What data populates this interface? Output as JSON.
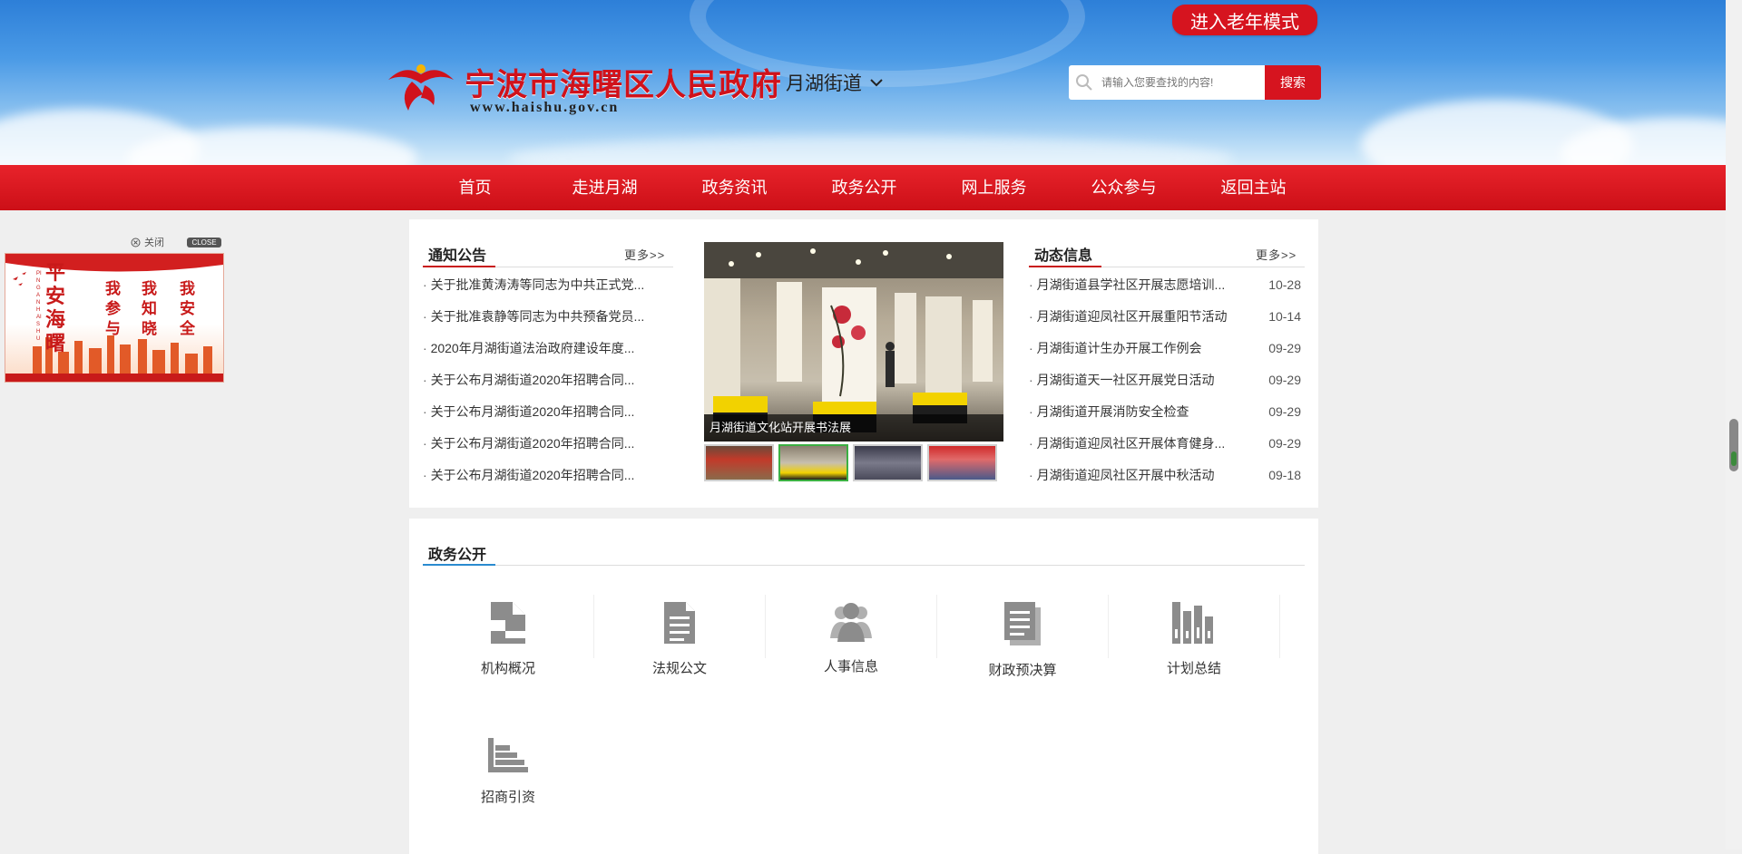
{
  "header": {
    "site_title": "宁波市海曙区人民政府",
    "site_url": "www.haishu.gov.cn",
    "district": "月湖街道",
    "elder_mode": "进入老年模式",
    "search": {
      "placeholder": "请输入您要查找的内容!",
      "button": "搜索"
    },
    "accent_color": "#d6141f"
  },
  "nav": {
    "items": [
      {
        "label": "首页"
      },
      {
        "label": "走进月湖"
      },
      {
        "label": "政务资讯"
      },
      {
        "label": "政务公开"
      },
      {
        "label": "网上服务"
      },
      {
        "label": "公众参与"
      },
      {
        "label": "返回主站"
      }
    ]
  },
  "ad": {
    "close_cn": "关闭",
    "close_en": "CLOSE",
    "slogan": "平安海曙",
    "pinyin": "PING AN HAI SHU",
    "columns": [
      "我参与",
      "我知晓",
      "我安全"
    ]
  },
  "notices": {
    "title": "通知公告",
    "more": "更多>>",
    "items": [
      {
        "text": "关于批准黄涛涛等同志为中共正式党..."
      },
      {
        "text": "关于批准袁静等同志为中共预备党员..."
      },
      {
        "text": "2020年月湖街道法治政府建设年度..."
      },
      {
        "text": "关于公布月湖街道2020年招聘合同..."
      },
      {
        "text": "关于公布月湖街道2020年招聘合同..."
      },
      {
        "text": "关于公布月湖街道2020年招聘合同..."
      },
      {
        "text": "关于公布月湖街道2020年招聘合同..."
      }
    ]
  },
  "carousel": {
    "caption": "月湖街道文化站开展书法展",
    "thumbs": 4,
    "active_index": 1
  },
  "news": {
    "title": "动态信息",
    "more": "更多>>",
    "items": [
      {
        "text": "月湖街道县学社区开展志愿培训...",
        "date": "10-28"
      },
      {
        "text": "月湖街道迎凤社区开展重阳节活动",
        "date": "10-14"
      },
      {
        "text": "月湖街道计生办开展工作例会",
        "date": "09-29"
      },
      {
        "text": "月湖街道天一社区开展党日活动",
        "date": "09-29"
      },
      {
        "text": "月湖街道开展消防安全检查",
        "date": "09-29"
      },
      {
        "text": "月湖街道迎凤社区开展体育健身...",
        "date": "09-29"
      },
      {
        "text": "月湖街道迎凤社区开展中秋活动",
        "date": "09-18"
      }
    ]
  },
  "gov_open": {
    "title": "政务公开",
    "items": [
      {
        "label": "机构概况",
        "icon": "building-doc-icon"
      },
      {
        "label": "法规公文",
        "icon": "document-icon"
      },
      {
        "label": "人事信息",
        "icon": "people-icon"
      },
      {
        "label": "财政预决算",
        "icon": "stacked-docs-icon"
      },
      {
        "label": "计划总结",
        "icon": "bar-chart-icon"
      },
      {
        "label": "招商引资",
        "icon": "horizontal-bars-icon"
      }
    ]
  }
}
